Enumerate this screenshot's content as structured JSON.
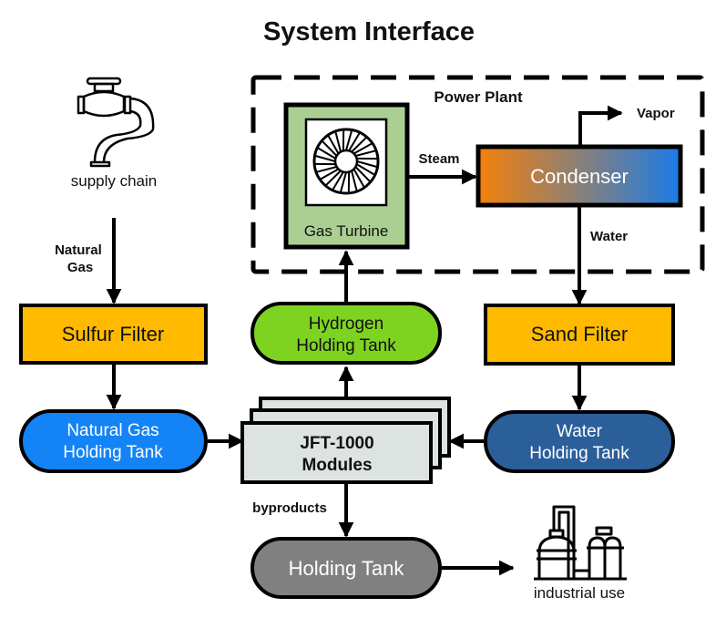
{
  "title": "System Interface",
  "colors": {
    "filter": "#FFBA00",
    "natural_gas_tank": "#1483F5",
    "hydrogen_tank": "#7ED321",
    "water_tank": "#2B5F9A",
    "holding_tank": "#808080",
    "turbine_bg": "#ABCF93",
    "modules": "#DCE3E1",
    "condenser_start": "#F5800A",
    "condenser_end": "#1A7BE8"
  },
  "supply": {
    "icon": "faucet-icon",
    "label": "supply chain"
  },
  "power_plant": {
    "label": "Power Plant"
  },
  "nodes": {
    "gas_turbine": {
      "label": "Gas Turbine",
      "icon": "turbine-icon"
    },
    "condenser": {
      "label": "Condenser"
    },
    "sulfur_filter": {
      "label": "Sulfur Filter"
    },
    "hydrogen_tank": {
      "line1": "Hydrogen",
      "line2": "Holding Tank"
    },
    "sand_filter": {
      "label": "Sand Filter"
    },
    "natural_gas_tank": {
      "line1": "Natural Gas",
      "line2": "Holding Tank"
    },
    "modules": {
      "line1": "JFT-1000",
      "line2": "Modules"
    },
    "water_tank": {
      "line1": "Water",
      "line2": "Holding Tank"
    },
    "holding_tank": {
      "label": "Holding Tank"
    }
  },
  "flows": {
    "natural_gas_line1": "Natural",
    "natural_gas_line2": "Gas",
    "steam": "Steam",
    "vapor": "Vapor",
    "water": "Water",
    "byproducts": "byproducts"
  },
  "industrial": {
    "icon": "factory-icon",
    "label": "industrial use"
  }
}
